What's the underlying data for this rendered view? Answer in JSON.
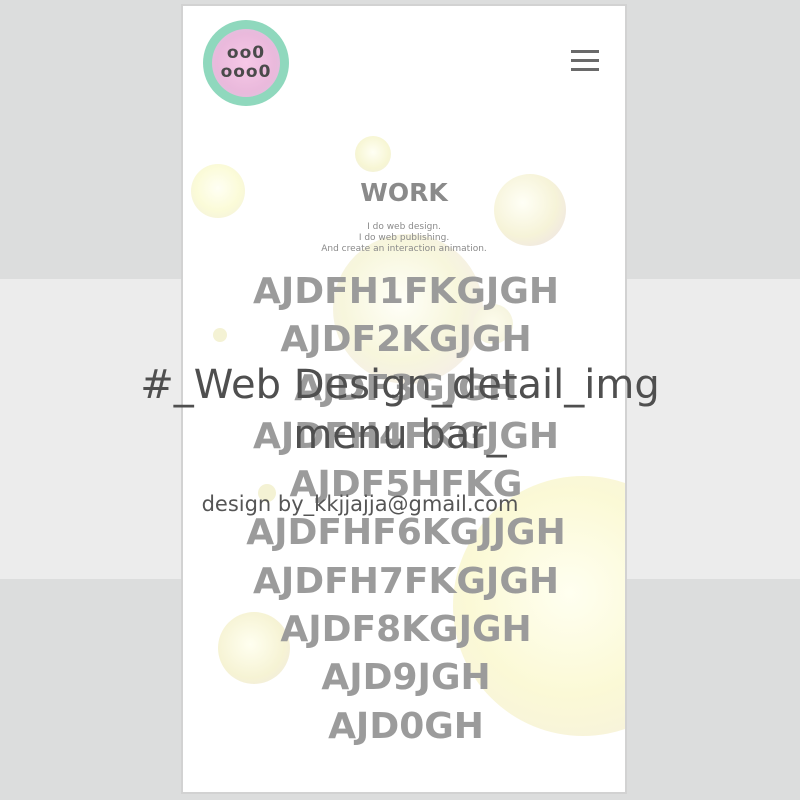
{
  "logo": {
    "line1": "oo0",
    "line2": "ooo0"
  },
  "menu": {
    "icon": "hamburger-menu-icon"
  },
  "section": {
    "title": "WORK",
    "description": [
      "I do web design.",
      "I do web publishing.",
      "And create an interaction animation."
    ]
  },
  "work_items": [
    "AJDFH1FKGJGH",
    "AJDF2KGJGH",
    "AJDF3GJGH",
    "AJDFH4FKGJGH",
    "AJDF5HFKG",
    "AJDFHF6KGJJGH",
    "AJDFH7FKGJGH",
    "AJDF8KGJGH",
    "AJD9JGH",
    "AJD0GH"
  ],
  "overlay": {
    "title_line1": "#_Web Design_detail_img",
    "title_line2": "menu bar_",
    "credit": "design by_kkjjajja@gmail.com"
  },
  "colors": {
    "background": "#dcdddd",
    "band": "#ececec",
    "logo_ring": "#8fd8bd",
    "logo_fill": "#eab9dc",
    "text_gray": "#9b9b9b"
  }
}
